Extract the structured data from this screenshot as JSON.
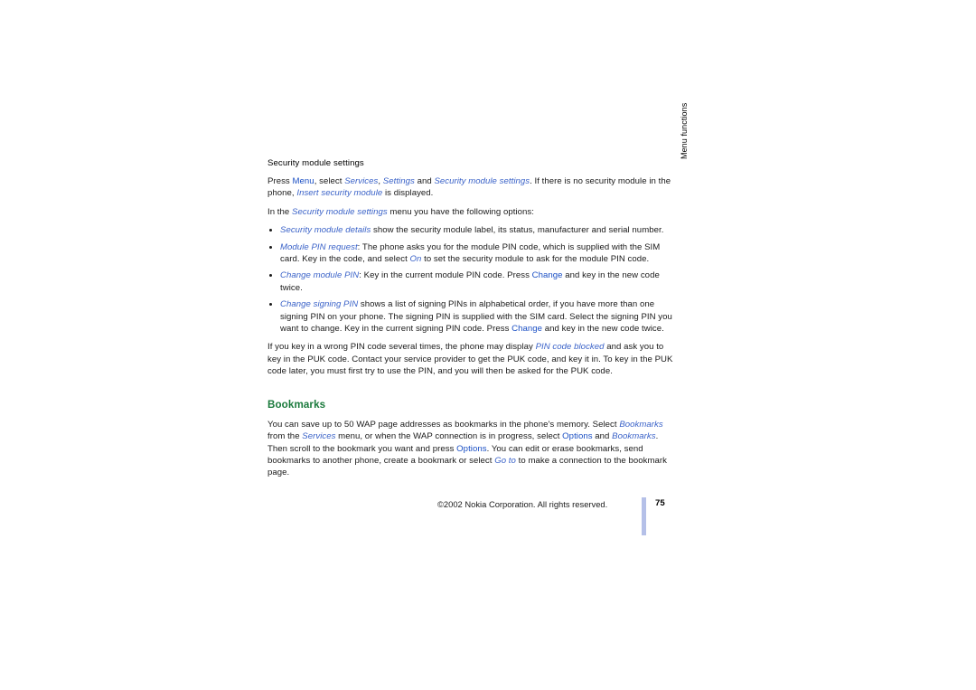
{
  "document": {
    "subheading": "Security module settings",
    "paragraphs": {
      "intro_1": "Press ",
      "intro_menu": "Menu",
      "intro_2": ", select ",
      "intro_services": "Services",
      "intro_3": ", ",
      "intro_settings": "Settings",
      "intro_4": " and ",
      "intro_sms": "Security module settings",
      "intro_5": ". If there is no security module in the phone, ",
      "intro_insert": "Insert security module",
      "intro_6": " is displayed.",
      "options_1": "In the ",
      "options_sms": "Security module settings",
      "options_2": " menu you have the following options:",
      "wrong_pin_1": "If you key in a wrong PIN code several times, the phone may display ",
      "wrong_pin_blocked": "PIN code blocked",
      "wrong_pin_2": " and ask you to key in the PUK code. Contact your service provider to get the PUK code, and key it in. To key in the PUK code later, you must first try to use the PIN, and you will then be asked for the PUK code."
    },
    "bullets": [
      {
        "term": "Security module details",
        "rest": " show the security module label, its status, manufacturer and serial number."
      },
      {
        "term": "Module PIN request",
        "rest_a": ": The phone asks you for the module PIN code, which is supplied with the SIM card. Key in the code, and select ",
        "inline_italic": "On",
        "rest_b": " to set the security module to ask for the module PIN code."
      },
      {
        "term": "Change module PIN",
        "rest_a": ": Key in the current module PIN code. Press ",
        "inline_key": "Change",
        "rest_b": " and key in the new code twice."
      },
      {
        "term": "Change signing PIN",
        "rest_a": " shows a list of signing PINs in alphabetical order, if you have more than one signing PIN on your phone. The signing PIN is supplied with the SIM card. Select the signing PIN you want to change. Key in the current signing PIN code. Press ",
        "inline_key": "Change",
        "rest_b": " and key in the new code twice."
      }
    ],
    "section": {
      "heading": "Bookmarks",
      "body_1": "You can save up to 50 WAP page addresses as bookmarks in the phone's memory. Select ",
      "body_bookmarks_1": "Bookmarks",
      "body_2": " from the ",
      "body_services": "Services",
      "body_3": " menu, or when the WAP connection is in progress, select ",
      "body_options_1": "Options",
      "body_4": " and ",
      "body_bookmarks_2": "Bookmarks",
      "body_5": ". Then scroll to the bookmark you want and press ",
      "body_options_2": "Options",
      "body_6": ". You can edit or erase bookmarks, send bookmarks to another phone, create a bookmark or select ",
      "body_goto": "Go to",
      "body_7": " to make a connection to the bookmark page."
    }
  },
  "side_tab": {
    "label": "Menu functions"
  },
  "footer": {
    "copyright": "©2002 Nokia Corporation. All rights reserved.",
    "page_number": "75"
  },
  "colors": {
    "ui_italic_blue": "#3a62c8",
    "ui_key_blue": "#1a4fc4",
    "section_green": "#1a7a3c",
    "footer_rule": "#b5c0e8",
    "background": "#ffffff"
  }
}
